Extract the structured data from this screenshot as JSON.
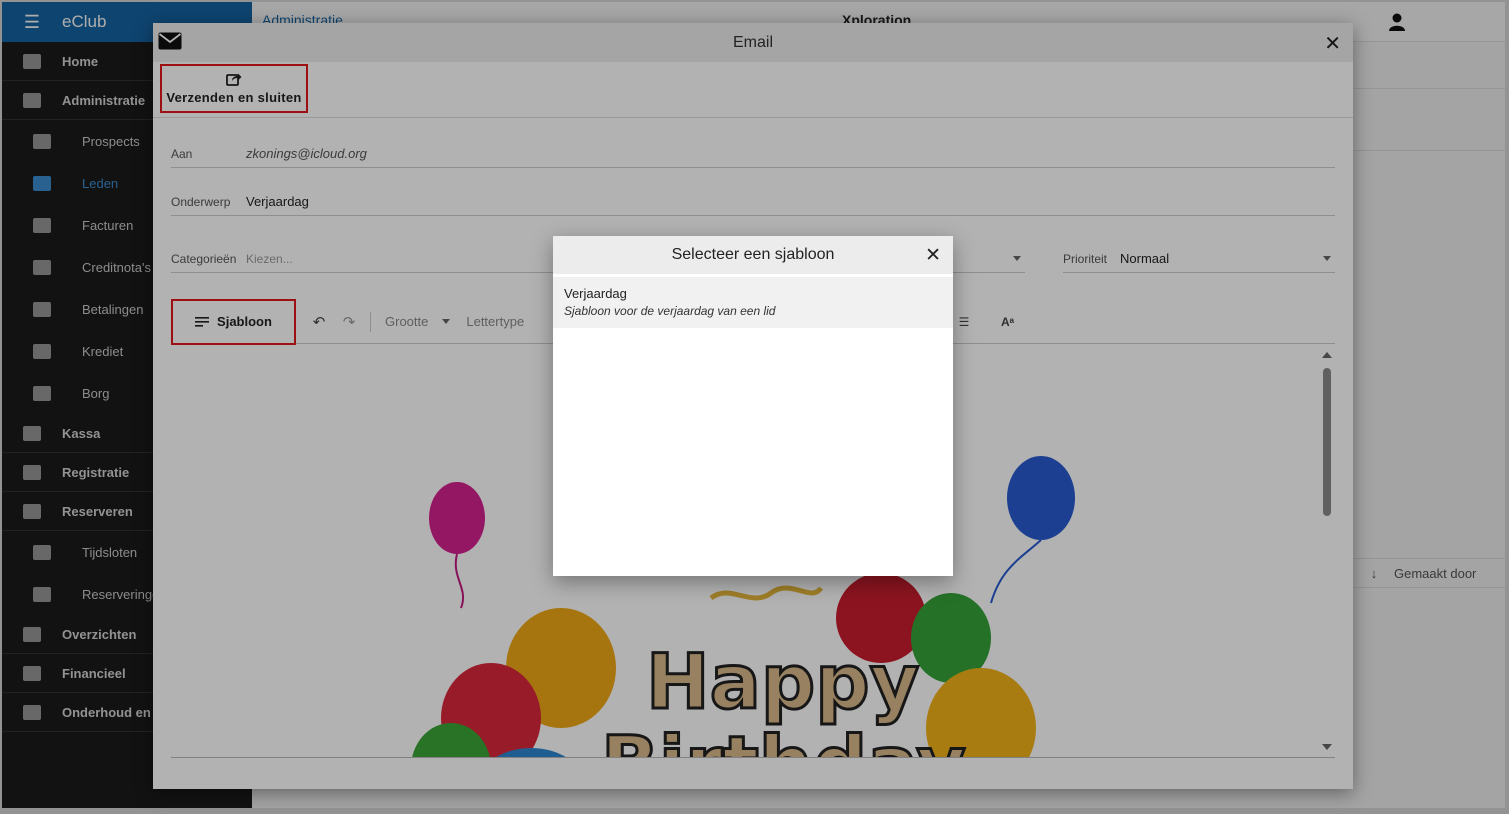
{
  "app": {
    "brand": "eClub",
    "breadcrumb": "Administratie",
    "org_title": "Xploration",
    "nav": [
      {
        "label": "Home",
        "type": "section"
      },
      {
        "label": "Administratie",
        "type": "section"
      },
      {
        "label": "Prospects",
        "type": "sub"
      },
      {
        "label": "Leden",
        "type": "sub",
        "active": true
      },
      {
        "label": "Facturen",
        "type": "sub"
      },
      {
        "label": "Creditnota's",
        "type": "sub"
      },
      {
        "label": "Betalingen",
        "type": "sub"
      },
      {
        "label": "Krediet",
        "type": "sub"
      },
      {
        "label": "Borg",
        "type": "sub"
      },
      {
        "label": "Kassa",
        "type": "section"
      },
      {
        "label": "Registratie",
        "type": "section"
      },
      {
        "label": "Reserveren",
        "type": "section"
      },
      {
        "label": "Tijdsloten",
        "type": "sub"
      },
      {
        "label": "Reserveringen",
        "type": "sub"
      },
      {
        "label": "Overzichten",
        "type": "section"
      },
      {
        "label": "Financieel",
        "type": "section"
      },
      {
        "label": "Onderhoud en b",
        "type": "section"
      }
    ],
    "bg_table_header": "Gemaakt door"
  },
  "email": {
    "title": "Email",
    "send_close_label": "Verzenden en sluiten",
    "to_label": "Aan",
    "to_value": "zkonings@icloud.org",
    "subject_label": "Onderwerp",
    "subject_value": "Verjaardag",
    "categories_label": "Categorieën",
    "categories_placeholder": "Kiezen...",
    "priority_label": "Prioriteit",
    "priority_value": "Normaal",
    "toolbar": {
      "template_label": "Sjabloon",
      "size_label": "Grootte",
      "font_label": "Lettertype",
      "font_size_icon": "Aᵃ"
    },
    "image_text": [
      "Happy",
      "Birthday"
    ]
  },
  "template_dialog": {
    "title": "Selecteer een sjabloon",
    "items": [
      {
        "name": "Verjaardag",
        "description": "Sjabloon voor de verjaardag van een lid"
      }
    ]
  },
  "colors": {
    "brand_blue": "#1565a5",
    "highlight_red": "#e0161b",
    "sidebar_bg": "#1b1b1b"
  }
}
